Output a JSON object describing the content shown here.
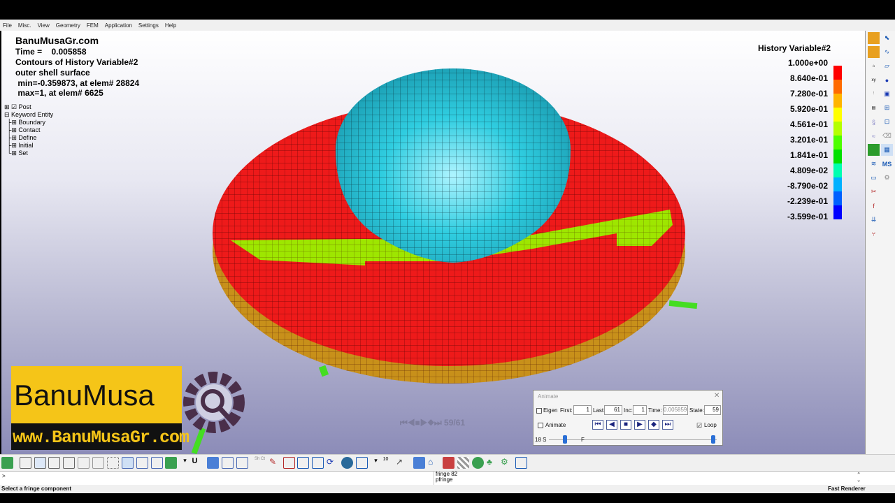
{
  "menu": [
    "File",
    "Misc.",
    "View",
    "Geometry",
    "FEM",
    "Application",
    "Settings",
    "Help"
  ],
  "info": {
    "site": "BanuMusaGr.com",
    "time_line": "Time =    0.005858",
    "contours": "Contours of History Variable#2",
    "surface": "outer shell surface",
    "min_line": " min=-0.359873, at elem# 28824",
    "max_line": " max=1, at elem# 6625"
  },
  "tree": {
    "post": "Post",
    "keyword_entity": "Keyword Entity",
    "children": [
      "Boundary",
      "Contact",
      "Define",
      "Initial",
      "Set"
    ]
  },
  "legend": {
    "title": "History Variable#2",
    "values": [
      "1.000e+00",
      "8.640e-01",
      "7.280e-01",
      "5.920e-01",
      "4.561e-01",
      "3.201e-01",
      "1.841e-01",
      "4.809e-02",
      "-8.790e-02",
      "-2.239e-01",
      "-3.599e-01"
    ],
    "colors": [
      "#ff0000",
      "#ff6a00",
      "#ffb400",
      "#ffff00",
      "#b4ff00",
      "#4cff00",
      "#00e000",
      "#00ffb0",
      "#00b0ff",
      "#0060ff",
      "#0000ff"
    ]
  },
  "playback_hint": "59/61",
  "animate": {
    "title": "Animate",
    "close": "✕",
    "eigen_label": "Eigen",
    "first_label": "First:",
    "first_value": "1",
    "last_label": "Last:",
    "last_value": "61",
    "inc_label": "Inc:",
    "inc_value": "1",
    "time_label": "Time:",
    "time_value": "0.005859",
    "state_label": "State:",
    "state_value": "59",
    "animate_label": "Animate",
    "loop_label": "Loop",
    "loop_checked": "☑",
    "speed_label": "18 S",
    "speed_label_f": "F",
    "controls": [
      "⏮",
      "◀",
      "■",
      "▶",
      "◆",
      "⏭"
    ]
  },
  "branding": {
    "name": "BanuMusa",
    "url": "www.BanuMusaGr.com",
    "accent": "#f5c518"
  },
  "cmd": {
    "prompt": ">",
    "history_1": "fringe 82",
    "history_2": "pfringe"
  },
  "status": {
    "left": "Select a fringe component",
    "right": "Fast Renderer"
  },
  "icons": {
    "gear": "gear-magnifier-icon"
  }
}
